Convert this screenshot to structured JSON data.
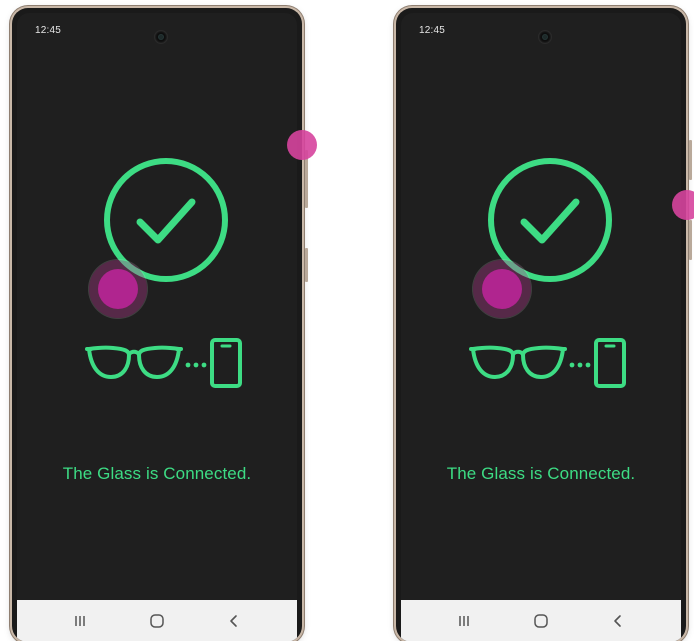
{
  "screens": [
    {
      "status": {
        "time": "12:45"
      },
      "message": "The Glass is Connected.",
      "icons": {
        "status_camera": "front-camera-icon",
        "main": "check-circle-icon",
        "pairing": "glasses-phone-pair-icon"
      },
      "nav": {
        "recents_icon": "recents-icon",
        "home_icon": "home-icon",
        "back_icon": "back-icon"
      }
    },
    {
      "status": {
        "time": "12:45"
      },
      "message": "The Glass is Connected.",
      "icons": {
        "status_camera": "front-camera-icon",
        "main": "check-circle-icon",
        "pairing": "glasses-phone-pair-icon"
      },
      "nav": {
        "recents_icon": "recents-icon",
        "home_icon": "home-icon",
        "back_icon": "back-icon"
      }
    }
  ],
  "colors": {
    "accent_green": "#3ddc84",
    "screen_bg": "#1f1f1f",
    "nav_bg": "#f1f1f1",
    "tap_indicator": "#b0258f"
  }
}
